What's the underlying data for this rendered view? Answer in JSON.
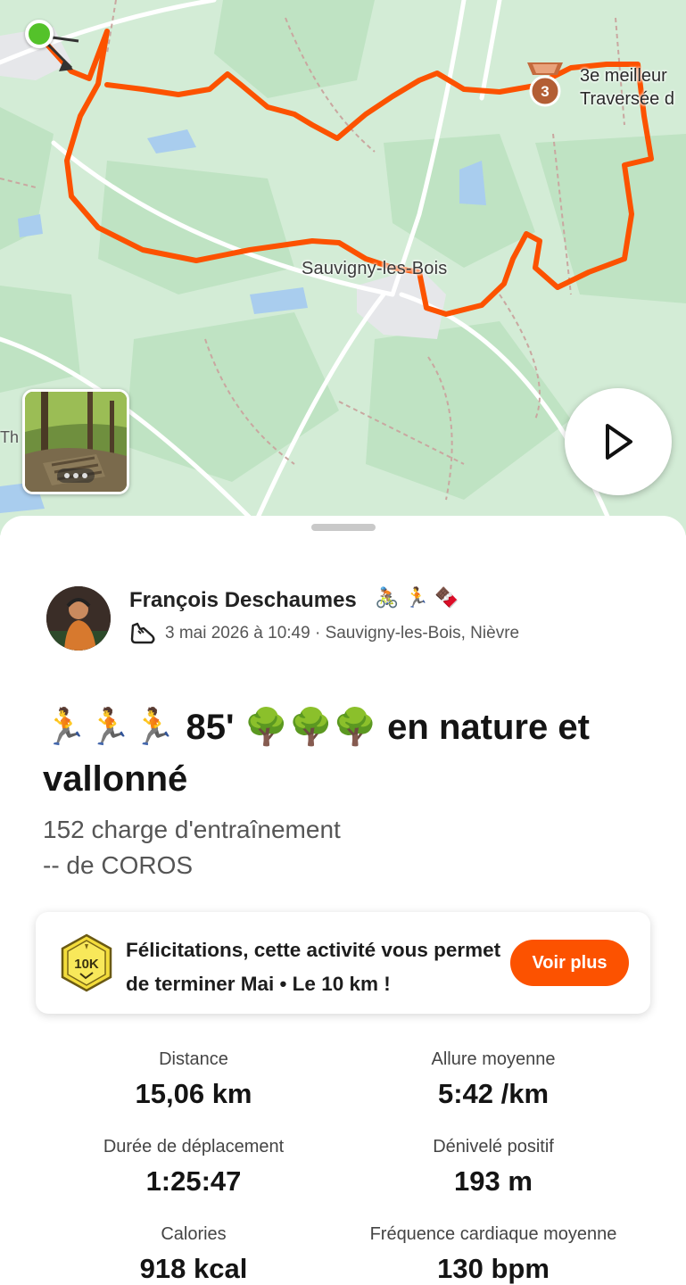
{
  "map": {
    "town_label": "Sauvigny-les-Bois",
    "edge_label": "Th",
    "segment_achievement": {
      "rank": "3",
      "line1": "3e meilleur",
      "line2": "Traversée d"
    },
    "route_color": "#fc5200",
    "icons": [
      "start-dot",
      "medal-icon",
      "play-icon"
    ]
  },
  "athlete": {
    "name": "François Deschaumes",
    "badges": "🚴🏽 🏃 🍫",
    "date_location": "3 mai 2026 à 10:49 · Sauvigny-les-Bois, Nièvre"
  },
  "activity": {
    "title": "🏃🏃🏃 85'  🌳🌳🌳 en nature et vallonné",
    "description_line1": "152 charge d'entraînement",
    "description_line2": "-- de COROS"
  },
  "challenge": {
    "badge_text": "10K",
    "text": "Félicitations, cette activité vous permet de terminer Mai • Le 10 km !",
    "button_label": "Voir plus",
    "accent": "#fc5200"
  },
  "stats": [
    {
      "label": "Distance",
      "value": "15,06 km"
    },
    {
      "label": "Allure moyenne",
      "value": "5:42 /km"
    },
    {
      "label": "Durée de déplacement",
      "value": "1:25:47"
    },
    {
      "label": "Dénivelé positif",
      "value": "193 m"
    },
    {
      "label": "Calories",
      "value": "918 kcal"
    },
    {
      "label": "Fréquence cardiaque moyenne",
      "value": "130 bpm"
    }
  ]
}
